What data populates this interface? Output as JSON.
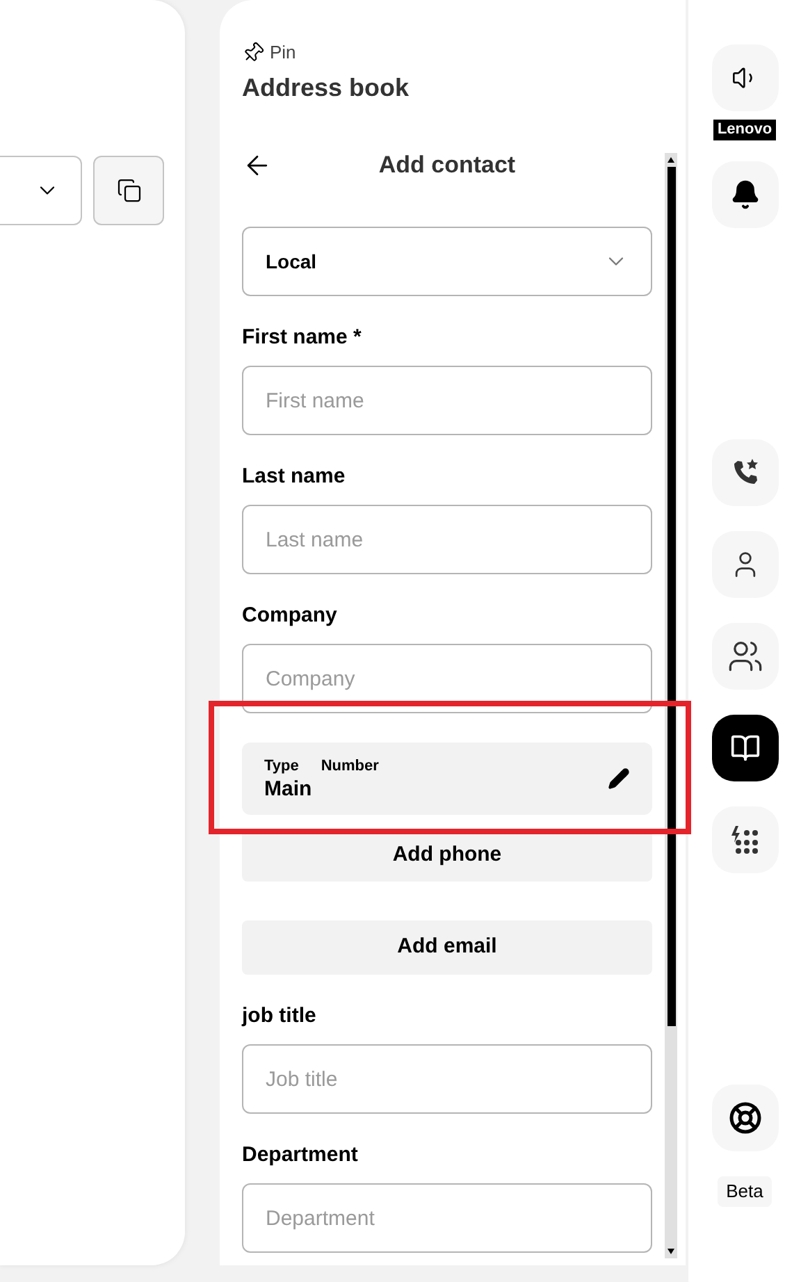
{
  "left_panel": {
    "dropdown": {
      "expanded": false
    }
  },
  "address_book": {
    "pin_label": "Pin",
    "title": "Address book"
  },
  "form": {
    "title": "Add contact",
    "source_select": {
      "value": "Local",
      "expanded": false
    },
    "fields": [
      {
        "label": "First name *",
        "placeholder": "First name"
      },
      {
        "label": "Last name",
        "placeholder": "Last name"
      },
      {
        "label": "Company",
        "placeholder": "Company"
      }
    ],
    "phone_entry": {
      "type_label": "Type",
      "number_label": "Number",
      "type_value": "Main",
      "highlighted": true
    },
    "buttons": [
      "Add phone",
      "Add email"
    ],
    "extra_fields": [
      {
        "label": "job title",
        "placeholder": "Job title"
      },
      {
        "label": "Department",
        "placeholder": "Department"
      }
    ]
  },
  "rail": {
    "top": [
      {
        "kind": "speaker",
        "caption": "Lenovo"
      },
      {
        "kind": "bell"
      }
    ],
    "nav": [
      {
        "kind": "favorites",
        "selected": false
      },
      {
        "kind": "contact",
        "selected": false
      },
      {
        "kind": "group",
        "selected": false
      },
      {
        "kind": "address-book",
        "selected": true
      },
      {
        "kind": "dialpad",
        "selected": false
      }
    ],
    "help": {
      "kind": "help"
    },
    "badge": "Beta"
  }
}
